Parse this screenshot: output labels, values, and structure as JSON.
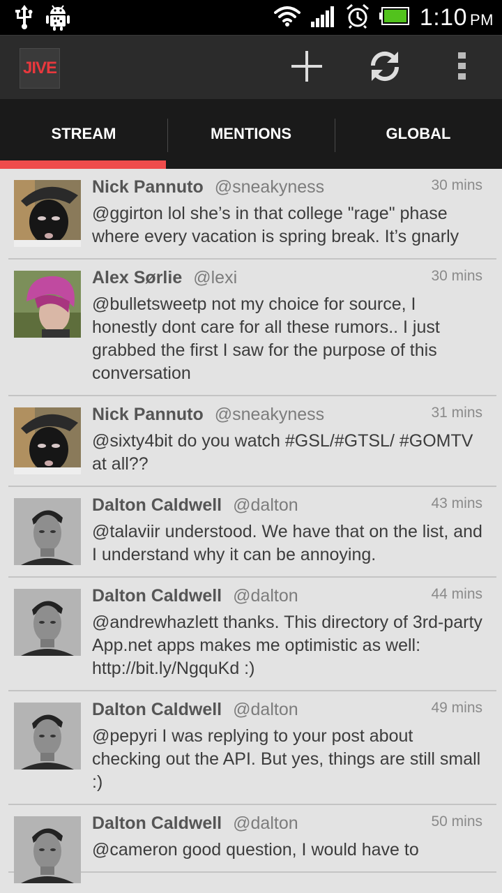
{
  "status_bar": {
    "time": "1:10",
    "ampm": "PM",
    "icons": [
      "usb-icon",
      "android-debug-icon",
      "wifi-icon",
      "signal-icon",
      "alarm-icon",
      "battery-icon"
    ],
    "battery_color": "#52c21d"
  },
  "action_bar": {
    "logo_text": "JIVE",
    "logo_color": "#e8383d",
    "actions": [
      "add-icon",
      "refresh-icon",
      "overflow-menu-icon"
    ]
  },
  "tabs": [
    {
      "label": "STREAM",
      "active": true
    },
    {
      "label": "MENTIONS",
      "active": false
    },
    {
      "label": "GLOBAL",
      "active": false
    }
  ],
  "accent_color": "#ef4c4c",
  "posts": [
    {
      "name": "Nick Pannuto",
      "handle": "@sneakyness",
      "time": "30 mins",
      "text": "@ggirton lol she’s in that college \"rage\" phase where every vacation is spring break. It’s gnarly",
      "avatar": "masked-face-avatar"
    },
    {
      "name": "Alex Sørlie",
      "handle": "@lexi",
      "time": "30 mins",
      "text": "@bulletsweetp not my choice for source, I honestly dont care for all these rumors.. I just grabbed the first I saw for the purpose of this conversation",
      "avatar": "pink-hair-avatar"
    },
    {
      "name": "Nick Pannuto",
      "handle": "@sneakyness",
      "time": "31 mins",
      "text": "@sixty4bit do you watch #GSL/#GTSL/ #GOMTV at all??",
      "avatar": "masked-face-avatar"
    },
    {
      "name": "Dalton Caldwell",
      "handle": "@dalton",
      "time": "43 mins",
      "text": "@talaviir understood. We have that on the list, and I understand why it can be annoying.",
      "avatar": "bw-portrait-avatar"
    },
    {
      "name": "Dalton Caldwell",
      "handle": "@dalton",
      "time": "44 mins",
      "text": "@andrewhazlett thanks. This directory of 3rd-party App.net apps makes me optimistic as well: http://bit.ly/NgquKd :)",
      "avatar": "bw-portrait-avatar"
    },
    {
      "name": "Dalton Caldwell",
      "handle": "@dalton",
      "time": "49 mins",
      "text": "@pepyri I was replying to your post about checking out the API. But yes, things are still small :)",
      "avatar": "bw-portrait-avatar"
    },
    {
      "name": "Dalton Caldwell",
      "handle": "@dalton",
      "time": "50 mins",
      "text": "@cameron good question, I would have to",
      "avatar": "bw-portrait-avatar"
    }
  ]
}
